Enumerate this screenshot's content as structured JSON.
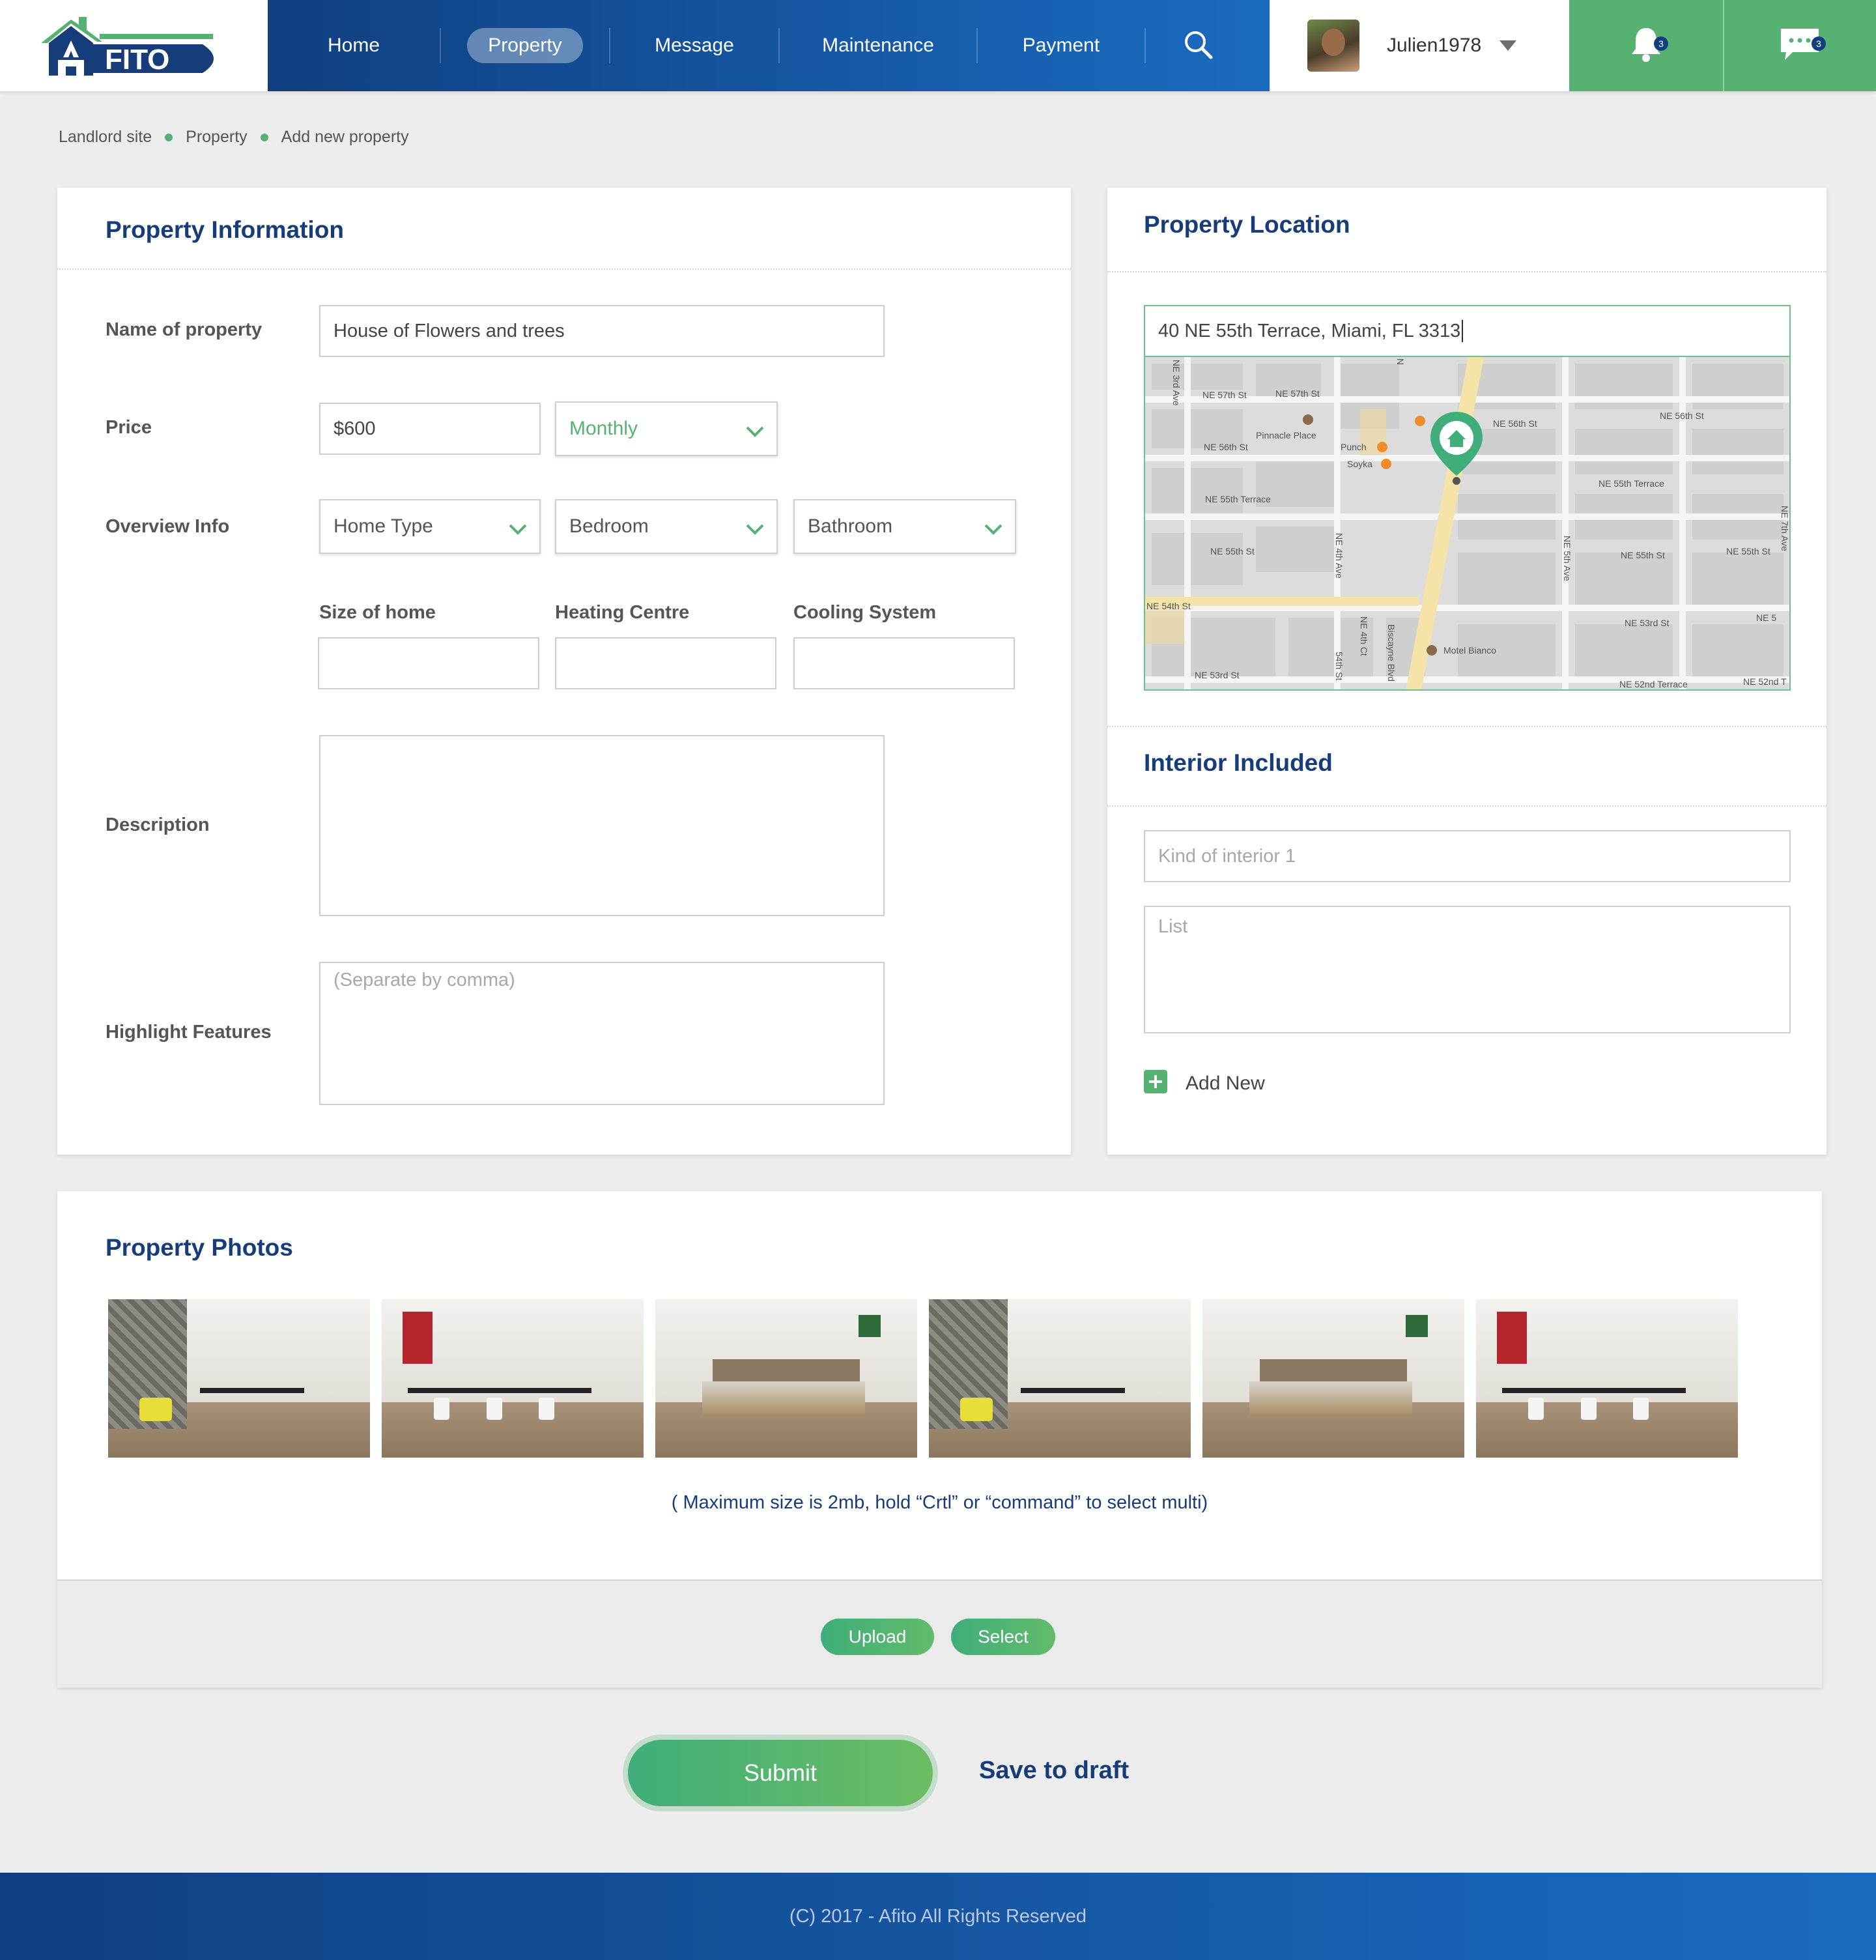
{
  "brand": {
    "logo_text": "AFITO",
    "accent": "#56b173",
    "navy": "#163d7a"
  },
  "nav": {
    "items": [
      {
        "label": "Home",
        "active": false
      },
      {
        "label": "Property",
        "active": true
      },
      {
        "label": "Message",
        "active": false
      },
      {
        "label": "Maintenance",
        "active": false
      },
      {
        "label": "Payment",
        "active": false
      }
    ],
    "search_icon": "search-icon"
  },
  "user": {
    "name": "Julien1978"
  },
  "notifications": {
    "bell_count": "3",
    "message_count": "3"
  },
  "breadcrumb": [
    "Landlord site",
    "Property",
    "Add new property"
  ],
  "property_info": {
    "title": "Property Information",
    "name_label": "Name of property",
    "name_value": "House of Flowers and trees",
    "price_label": "Price",
    "price_value": "$600",
    "price_period": "Monthly",
    "overview_label": "Overview Info",
    "home_type": "Home Type",
    "bedroom": "Bedroom",
    "bathroom": "Bathroom",
    "size_label": "Size of home",
    "heating_label": "Heating Centre",
    "cooling_label": "Cooling System",
    "description_label": "Description",
    "highlight_label": "Highlight Features",
    "highlight_placeholder": "(Separate by comma)"
  },
  "location": {
    "title": "Property Location",
    "address": "40 NE 55th Terrace, Miami, FL 3313",
    "map_labels": {
      "ne57_a": "NE 57th St",
      "ne57_b": "NE 57th St",
      "pinnacle": "Pinnacle Place",
      "ne56_a": "NE 56th St",
      "ne56_b": "NE 56th St",
      "ne56_c": "NE 56th St",
      "punch": "Punch",
      "soyka": "Soyka",
      "ne55t_a": "NE 55th Terrace",
      "ne55t_b": "NE 55th Terrace",
      "ne55_a": "NE 55th St",
      "ne55_b": "NE 55th St",
      "ne55_c": "NE 55th St",
      "ne54": "NE 54th St",
      "ne53_a": "NE 53rd St",
      "ne53_b": "NE 53rd St",
      "motel": "Motel Bianco",
      "ne52_a": "NE 52nd Terrace",
      "ne52_b": "NE 52nd T",
      "biscayne": "Biscayne Blvd",
      "ne3": "NE 3rd Ave",
      "ne4": "NE 4th Ave",
      "ne4ct": "NE 4th Ct",
      "ne5": "NE 5th Ave",
      "ne5_short": "NE 5",
      "ne7": "NE 7th Ave",
      "n_short": "N",
      "st54": "54th St"
    }
  },
  "interior": {
    "title": "Interior Included",
    "kind_placeholder": "Kind of interior 1",
    "list_placeholder": "List",
    "add_new": "Add New"
  },
  "photos": {
    "title": "Property Photos",
    "items": [
      "living-room-photo",
      "dining-room-photo",
      "bedroom-photo",
      "living-room-photo",
      "bedroom-photo",
      "dining-room-photo"
    ],
    "note": "( Maximum size is 2mb, hold “Crtl” or “command” to select multi)",
    "upload_label": "Upload",
    "select_label": "Select"
  },
  "actions": {
    "submit_label": "Submit",
    "draft_label": "Save to draft"
  },
  "footer": {
    "copyright": "(C) 2017 - Afito All Rights Reserved"
  }
}
